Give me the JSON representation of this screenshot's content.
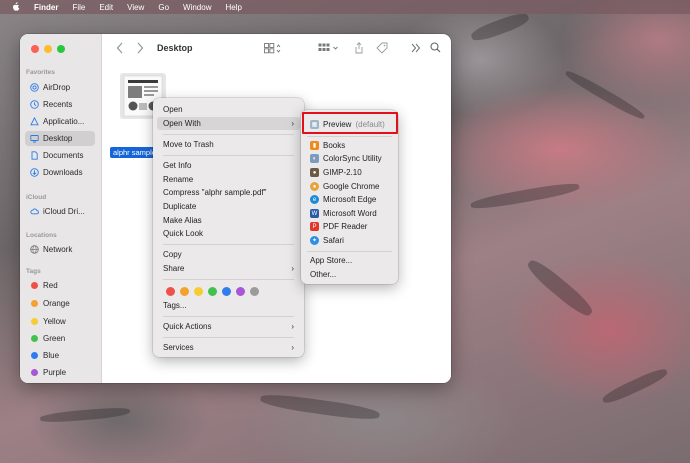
{
  "menubar": {
    "apple": "",
    "app_name": "Finder",
    "items": [
      "File",
      "Edit",
      "View",
      "Go",
      "Window",
      "Help"
    ]
  },
  "window": {
    "title": "Desktop"
  },
  "sidebar": {
    "favorites_heading": "Favorites",
    "favorites": [
      {
        "label": "AirDrop",
        "icon": "airdrop-icon"
      },
      {
        "label": "Recents",
        "icon": "clock-icon"
      },
      {
        "label": "Applicatio...",
        "icon": "applications-icon"
      },
      {
        "label": "Desktop",
        "icon": "desktop-icon"
      },
      {
        "label": "Documents",
        "icon": "document-icon"
      },
      {
        "label": "Downloads",
        "icon": "download-icon"
      }
    ],
    "icloud_heading": "iCloud",
    "icloud": [
      {
        "label": "iCloud Dri...",
        "icon": "cloud-icon"
      }
    ],
    "locations_heading": "Locations",
    "locations": [
      {
        "label": "Network",
        "icon": "globe-icon"
      }
    ],
    "tags_heading": "Tags",
    "tags": [
      {
        "label": "Red",
        "color": "#f0504a"
      },
      {
        "label": "Orange",
        "color": "#f4a12f"
      },
      {
        "label": "Yellow",
        "color": "#f5cd33"
      },
      {
        "label": "Green",
        "color": "#43c14f"
      },
      {
        "label": "Blue",
        "color": "#2f7cf0"
      },
      {
        "label": "Purple",
        "color": "#a757d5"
      }
    ]
  },
  "file": {
    "label": "alphr sample"
  },
  "context_menu": {
    "items": [
      "Open",
      "Open With",
      "Move to Trash",
      "Get Info",
      "Rename",
      "Compress \"alphr sample.pdf\"",
      "Duplicate",
      "Make Alias",
      "Quick Look",
      "Copy",
      "Share",
      "Tags...",
      "Quick Actions",
      "Services"
    ],
    "tag_colors": [
      "#f0504a",
      "#f4a12f",
      "#f5cd33",
      "#43c14f",
      "#2f7cf0",
      "#a757d5",
      "#9b9b9b"
    ]
  },
  "open_with": {
    "default_app": "Preview",
    "default_note": "(default)",
    "apps": [
      {
        "label": "Books",
        "color": "#f08a1c"
      },
      {
        "label": "ColorSync Utility",
        "color": "#7c9bbf"
      },
      {
        "label": "GIMP-2.10",
        "color": "#6b5a44"
      },
      {
        "label": "Google Chrome",
        "color": "#e8a23a"
      },
      {
        "label": "Microsoft Edge",
        "color": "#1e8ad6"
      },
      {
        "label": "Microsoft Word",
        "color": "#2b5aa7"
      },
      {
        "label": "PDF Reader",
        "color": "#e0362c"
      },
      {
        "label": "Safari",
        "color": "#2c8fe6"
      }
    ],
    "app_store": "App Store...",
    "other": "Other..."
  }
}
